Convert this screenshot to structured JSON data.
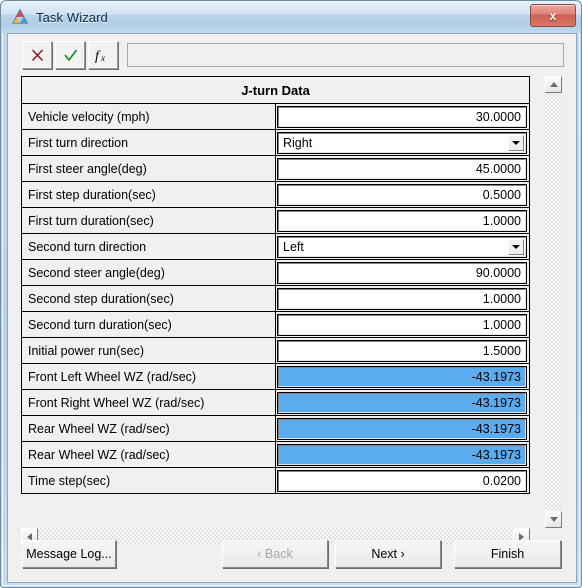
{
  "window": {
    "title": "Task Wizard",
    "icon": "delta-triangle-icon",
    "close_label": "x"
  },
  "toolbar": {
    "cancel_icon": "red-x-icon",
    "accept_icon": "green-check-icon",
    "function_icon": "fx-function-icon",
    "formula_value": ""
  },
  "grid": {
    "header": "J-turn Data",
    "rows": [
      {
        "label": "Vehicle velocity (mph)",
        "value": "30.0000",
        "type": "number",
        "selected": false
      },
      {
        "label": "First turn direction",
        "value": "Right",
        "type": "combo",
        "selected": false
      },
      {
        "label": "First steer angle(deg)",
        "value": "45.0000",
        "type": "number",
        "selected": false
      },
      {
        "label": "First step duration(sec)",
        "value": "0.5000",
        "type": "number",
        "selected": false
      },
      {
        "label": "First turn duration(sec)",
        "value": "1.0000",
        "type": "number",
        "selected": false
      },
      {
        "label": "Second turn direction",
        "value": "Left",
        "type": "combo",
        "selected": false
      },
      {
        "label": "Second steer angle(deg)",
        "value": "90.0000",
        "type": "number",
        "selected": false
      },
      {
        "label": "Second step duration(sec)",
        "value": "1.0000",
        "type": "number",
        "selected": false
      },
      {
        "label": "Second turn duration(sec)",
        "value": "1.0000",
        "type": "number",
        "selected": false
      },
      {
        "label": "Initial power run(sec)",
        "value": "1.5000",
        "type": "number",
        "selected": false
      },
      {
        "label": "Front Left Wheel WZ (rad/sec)",
        "value": "-43.1973",
        "type": "number",
        "selected": true
      },
      {
        "label": "Front Right Wheel WZ (rad/sec)",
        "value": "-43.1973",
        "type": "number",
        "selected": true
      },
      {
        "label": "Rear Wheel WZ (rad/sec)",
        "value": "-43.1973",
        "type": "number",
        "selected": true
      },
      {
        "label": "Rear Wheel WZ (rad/sec)",
        "value": "-43.1973",
        "type": "number",
        "selected": true
      },
      {
        "label": "Time step(sec)",
        "value": "0.0200",
        "type": "number",
        "selected": false
      }
    ]
  },
  "scrollbars": {
    "up_icon": "arrow-up-icon",
    "down_icon": "arrow-down-icon",
    "left_icon": "arrow-left-icon",
    "right_icon": "arrow-right-icon"
  },
  "buttons": {
    "message_log": "Message Log...",
    "back": "‹ Back",
    "next": "Next ›",
    "finish": "Finish"
  },
  "colors": {
    "selection_blue": "#5bacee",
    "titlebar_blue": "#b9d2ea",
    "close_red": "#cf5f52",
    "accept_green": "#1f8b2a",
    "cancel_red": "#8b2020"
  }
}
